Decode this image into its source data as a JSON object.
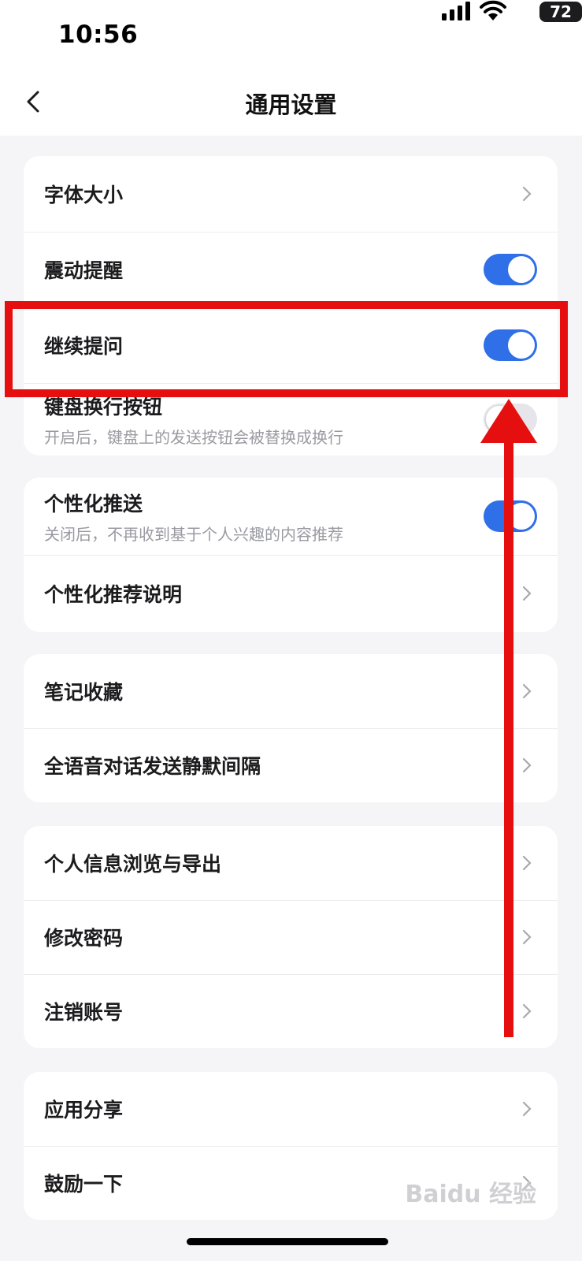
{
  "status_bar": {
    "time": "10:56",
    "battery": "72"
  },
  "nav": {
    "title": "通用设置"
  },
  "groups": [
    {
      "items": [
        {
          "label": "字体大小",
          "control": "chevron"
        },
        {
          "label": "震动提醒",
          "control": "toggle",
          "on": true
        },
        {
          "label": "继续提问",
          "control": "toggle",
          "on": true
        },
        {
          "label": "键盘换行按钮",
          "sub": "开启后，键盘上的发送按钮会被替换成换行",
          "control": "toggle",
          "on": false
        }
      ]
    },
    {
      "items": [
        {
          "label": "个性化推送",
          "sub": "关闭后，不再收到基于个人兴趣的内容推荐",
          "control": "toggle",
          "on": true
        },
        {
          "label": "个性化推荐说明",
          "control": "chevron"
        }
      ]
    },
    {
      "items": [
        {
          "label": "笔记收藏",
          "control": "chevron"
        },
        {
          "label": "全语音对话发送静默间隔",
          "control": "chevron"
        }
      ]
    },
    {
      "items": [
        {
          "label": "个人信息浏览与导出",
          "control": "chevron"
        },
        {
          "label": "修改密码",
          "control": "chevron"
        },
        {
          "label": "注销账号",
          "control": "chevron"
        }
      ]
    },
    {
      "items": [
        {
          "label": "应用分享",
          "control": "chevron"
        },
        {
          "label": "鼓励一下",
          "control": "chevron"
        }
      ]
    }
  ],
  "annotation": {
    "color": "#e60f0f"
  },
  "watermark": "Baidu 经验",
  "colors": {
    "toggle_on": "#2f6fe8",
    "background": "#f5f5f7"
  }
}
